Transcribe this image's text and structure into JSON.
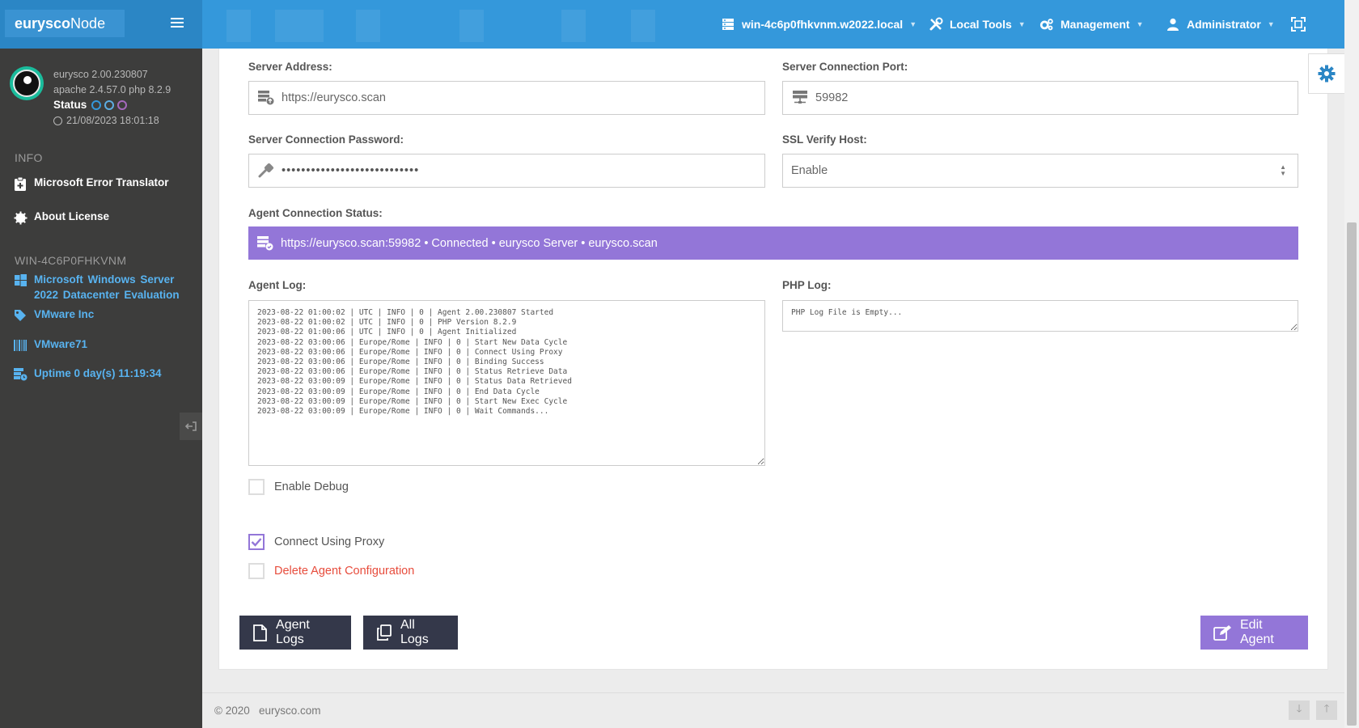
{
  "brand": {
    "bold": "eurysco",
    "light": "Node"
  },
  "topnav": {
    "host": "win-4c6p0fhkvnm.w2022.local",
    "local_tools": "Local Tools",
    "management": "Management",
    "user": "Administrator"
  },
  "profile": {
    "version": "eurysco 2.00.230807",
    "stack": "apache 2.4.57.0  php 8.2.9",
    "status_label": "Status",
    "datetime": "21/08/2023 18:01:18"
  },
  "sidebar": {
    "info_title": "INFO",
    "info_items": [
      {
        "label": "Microsoft Error Translator"
      },
      {
        "label": "About License"
      }
    ],
    "host_title": "WIN-4C6P0FHKVNM",
    "host_items": [
      {
        "label": "Microsoft  Windows  Server 2022  Datacenter  Evaluation"
      },
      {
        "label": "VMware Inc"
      },
      {
        "label": "VMware71"
      },
      {
        "label": "Uptime 0 day(s) 11:19:34"
      }
    ]
  },
  "form": {
    "server_address_label": "Server Address:",
    "server_address_value": "https://eurysco.scan",
    "port_label": "Server Connection Port:",
    "port_value": "59982",
    "password_label": "Server Connection Password:",
    "password_value": "••••••••••••••••••••••••••••",
    "ssl_label": "SSL Verify Host:",
    "ssl_value": "Enable",
    "agent_status_label": "Agent Connection Status:",
    "agent_status_value": "https://eurysco.scan:59982 • Connected • eurysco Server • eurysco.scan",
    "agent_log_label": "Agent Log:",
    "agent_log": "2023-08-22 01:00:02 | UTC | INFO | 0 | Agent 2.00.230807 Started\n2023-08-22 01:00:02 | UTC | INFO | 0 | PHP Version 8.2.9\n2023-08-22 01:00:06 | UTC | INFO | 0 | Agent Initialized\n2023-08-22 03:00:06 | Europe/Rome | INFO | 0 | Start New Data Cycle\n2023-08-22 03:00:06 | Europe/Rome | INFO | 0 | Connect Using Proxy\n2023-08-22 03:00:06 | Europe/Rome | INFO | 0 | Binding Success\n2023-08-22 03:00:06 | Europe/Rome | INFO | 0 | Status Retrieve Data\n2023-08-22 03:00:09 | Europe/Rome | INFO | 0 | Status Data Retrieved\n2023-08-22 03:00:09 | Europe/Rome | INFO | 0 | End Data Cycle\n2023-08-22 03:00:09 | Europe/Rome | INFO | 0 | Start New Exec Cycle\n2023-08-22 03:00:09 | Europe/Rome | INFO | 0 | Wait Commands...",
    "php_log_label": "PHP Log:",
    "php_log": "PHP Log File is Empty...",
    "enable_debug": {
      "label": "Enable Debug",
      "checked": false
    },
    "connect_proxy": {
      "label": "Connect Using Proxy",
      "checked": true
    },
    "delete_config": {
      "label": "Delete Agent Configuration",
      "checked": false
    }
  },
  "buttons": {
    "agent_logs": "Agent Logs",
    "all_logs": "All Logs",
    "edit_agent": "Edit Agent"
  },
  "footer": {
    "text": "© 2020   eurysco.com"
  },
  "colors": {
    "topbar": "#3498db",
    "sidebar": "#3d3d3c",
    "accent_purple": "#9376d8",
    "danger": "#e74c3c",
    "dark_button": "#34384a"
  }
}
